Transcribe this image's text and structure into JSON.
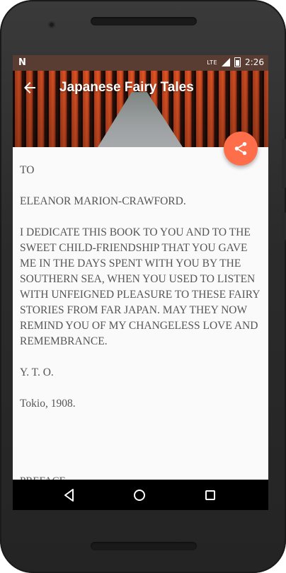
{
  "status": {
    "left_icon": "N",
    "network": "LTE",
    "time": "2:26"
  },
  "toolbar": {
    "title": "Japanese Fairy Tales",
    "back_icon": "arrow-left-icon",
    "share_icon": "share-icon"
  },
  "content": {
    "paragraphs": [
      "TO",
      "ELEANOR MARION-CRAWFORD.",
      "I DEDICATE THIS BOOK TO YOU AND TO THE SWEET CHILD-FRIENDSHIP THAT YOU GAVE ME IN THE DAYS SPENT WITH YOU BY THE SOUTHERN SEA, WHEN YOU USED TO LISTEN WITH UNFEIGNED PLEASURE TO THESE FAIRY STORIES FROM FAR JAPAN. MAY THEY NOW REMIND YOU OF MY CHANGELESS LOVE AND REMEMBRANCE.",
      "Y. T. O.",
      "Tokio, 1908."
    ],
    "next_heading": "PREFACE"
  },
  "nav": {
    "back_icon": "triangle-back-icon",
    "home_icon": "circle-home-icon",
    "recent_icon": "square-recent-icon"
  },
  "colors": {
    "accent": "#ff6e4a",
    "status_bar": "#5a3d32"
  }
}
